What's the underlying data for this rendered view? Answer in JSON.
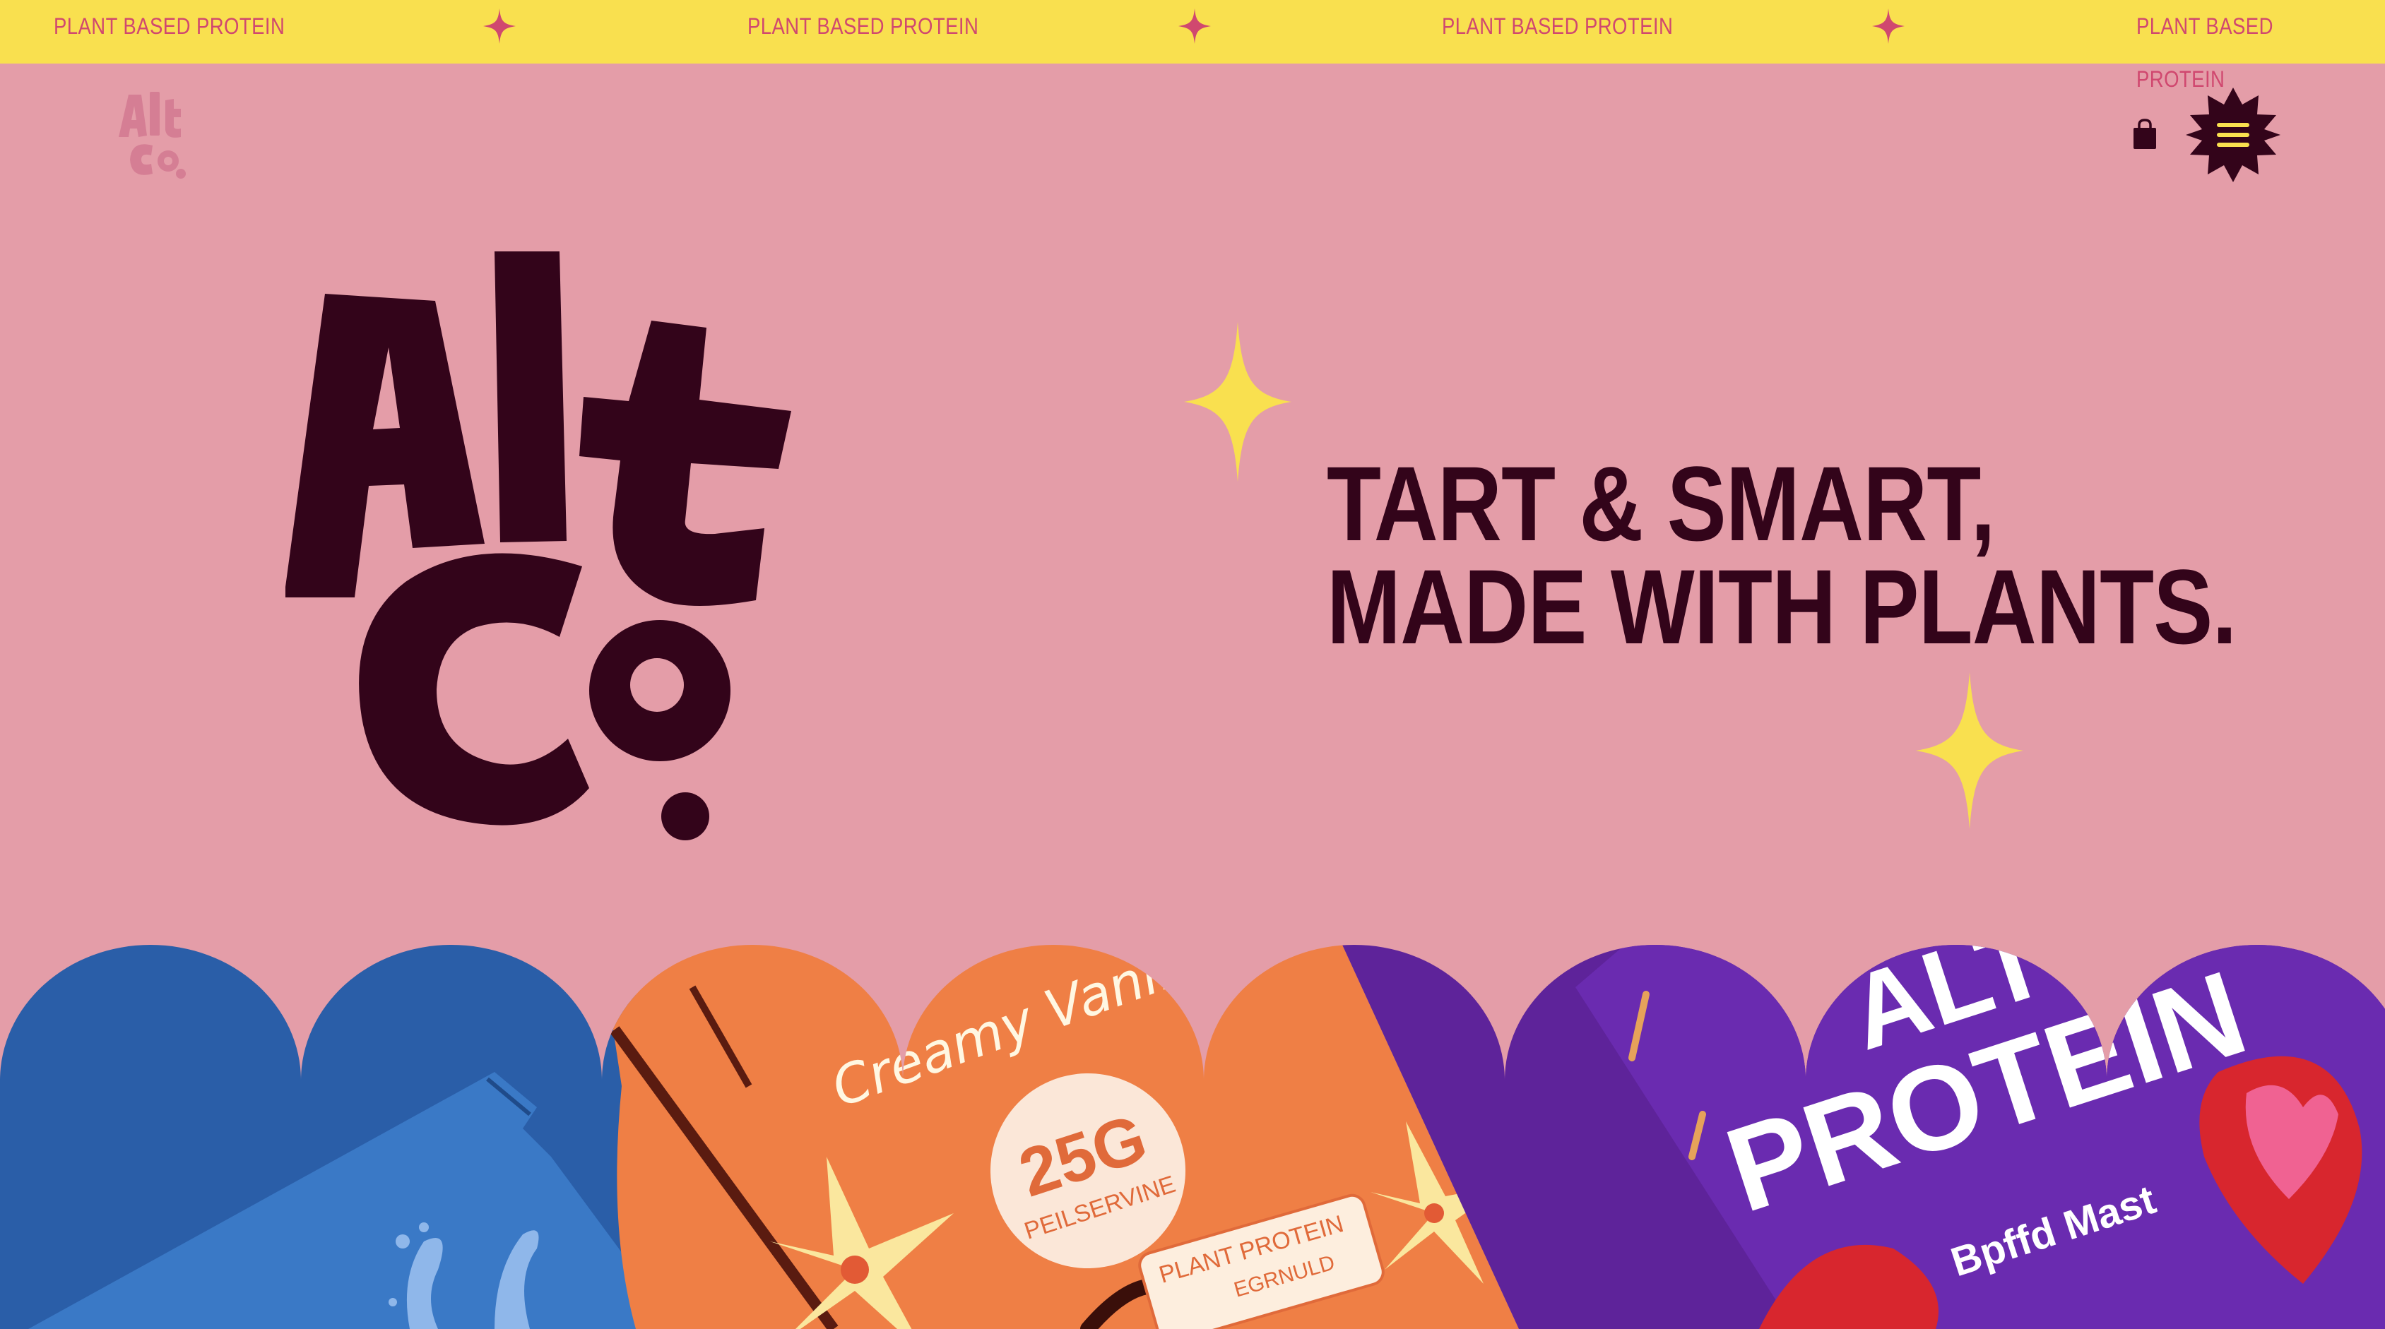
{
  "ticker": {
    "items": [
      "PLANT BASED PROTEIN",
      "PLANT BASED PROTEIN",
      "PLANT BASED PROTEIN",
      "PLANT BASED PROTEIN"
    ]
  },
  "header": {
    "logo_text": "Alt Co",
    "cart_icon": "shopping-bag-icon",
    "menu_icon": "hamburger-menu-icon"
  },
  "hero": {
    "logo_text": "Alt Co",
    "tagline_line1": "TART & SMART,",
    "tagline_line2": "MADE WITH PLANTS."
  },
  "products": {
    "vanilla_flavor": "Creamy Vanilla",
    "vanilla_badge_value": "25G",
    "vanilla_badge_label": "PEILSERVINE",
    "vanilla_tag_line1": "PLANT PROTEIN",
    "vanilla_tag_line2": "EGRNULD",
    "berry_headline_top": "ALT CO",
    "berry_headline": "PROTEIN",
    "berry_sub": "Bpffd Mast"
  },
  "colors": {
    "background": "#e49da8",
    "ticker_bg": "#f9e04f",
    "ticker_text": "#d0486f",
    "dark": "#33041a",
    "star_yellow": "#f9e04f",
    "pack_blue": "#2a5ea8",
    "pack_orange": "#ef7f45",
    "pack_purple": "#5e239a"
  }
}
